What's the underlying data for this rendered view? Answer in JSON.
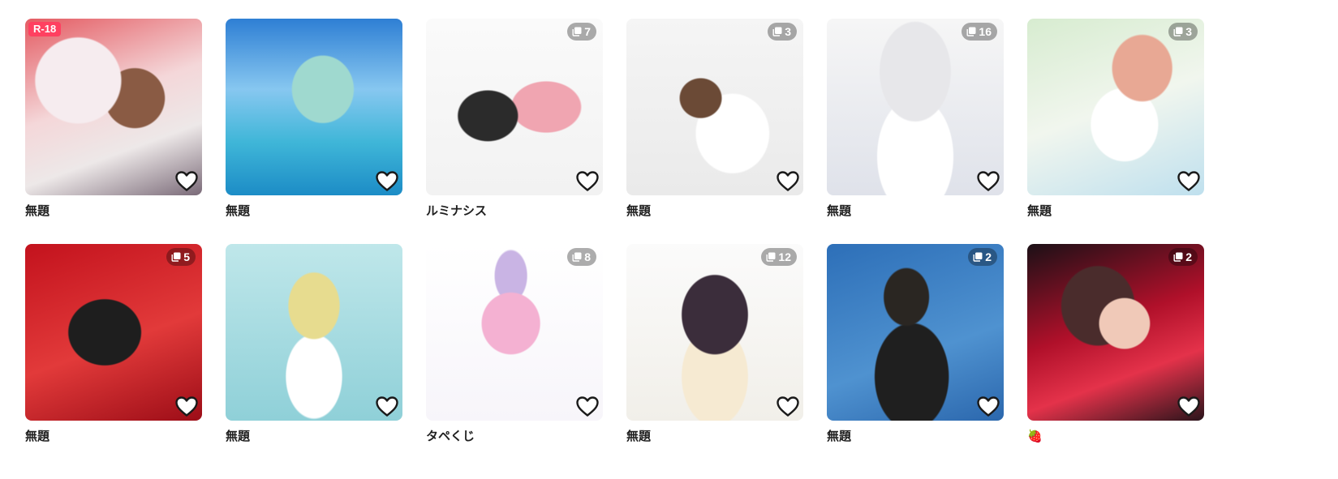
{
  "colors": {
    "r18_badge": "#ff4060",
    "title_text": "#1f1f1f",
    "count_badge_bg": "rgba(0,0,0,0.32)",
    "heart_stroke": "#1a1a1a"
  },
  "icons": {
    "page_count": "pages-icon",
    "like": "heart-outline-icon",
    "strawberry": "strawberry-emoji-icon"
  },
  "works": [
    {
      "title": "無題",
      "r18": "R-18",
      "count": ""
    },
    {
      "title": "無題",
      "r18": "",
      "count": ""
    },
    {
      "title": "ルミナシス",
      "r18": "",
      "count": "7"
    },
    {
      "title": "無題",
      "r18": "",
      "count": "3"
    },
    {
      "title": "無題",
      "r18": "",
      "count": "16"
    },
    {
      "title": "無題",
      "r18": "",
      "count": "3"
    },
    {
      "title": "無題",
      "r18": "",
      "count": "5"
    },
    {
      "title": "無題",
      "r18": "",
      "count": ""
    },
    {
      "title": "タペくじ",
      "r18": "",
      "count": "8"
    },
    {
      "title": "無題",
      "r18": "",
      "count": "12"
    },
    {
      "title": "無題",
      "r18": "",
      "count": "2"
    },
    {
      "title": "🍓",
      "r18": "",
      "count": "2"
    }
  ]
}
